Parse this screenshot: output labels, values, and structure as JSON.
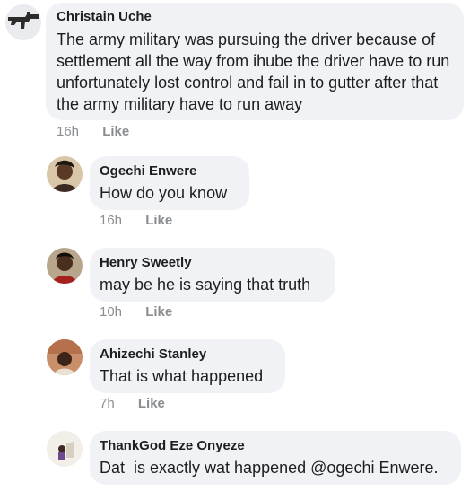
{
  "comments": [
    {
      "author": "Christain Uche",
      "text": "The army military was pursuing the driver because of settlement all the way from ihube the driver have to run unfortunately lost control and fail in to gutter after that the army military have to run away",
      "time": "16h",
      "like_label": "Like",
      "avatar_icon": "rifle-icon"
    }
  ],
  "replies": [
    {
      "author": "Ogechi Enwere",
      "text": "How do you know",
      "time": "16h",
      "like_label": "Like"
    },
    {
      "author": "Henry Sweetly",
      "text": "may be he is saying that truth",
      "time": "10h",
      "like_label": "Like"
    },
    {
      "author": "Ahizechi Stanley",
      "text": "That is what happened",
      "time": "7h",
      "like_label": "Like"
    },
    {
      "author": "ThankGod Eze Onyeze",
      "text": "Dat  is exactly wat happened @ogechi Enwere.",
      "time": "",
      "like_label": ""
    }
  ],
  "colors": {
    "bubble": "#f0f2f5",
    "meta_text": "#8a8d91",
    "author_text": "#1c1e21"
  }
}
